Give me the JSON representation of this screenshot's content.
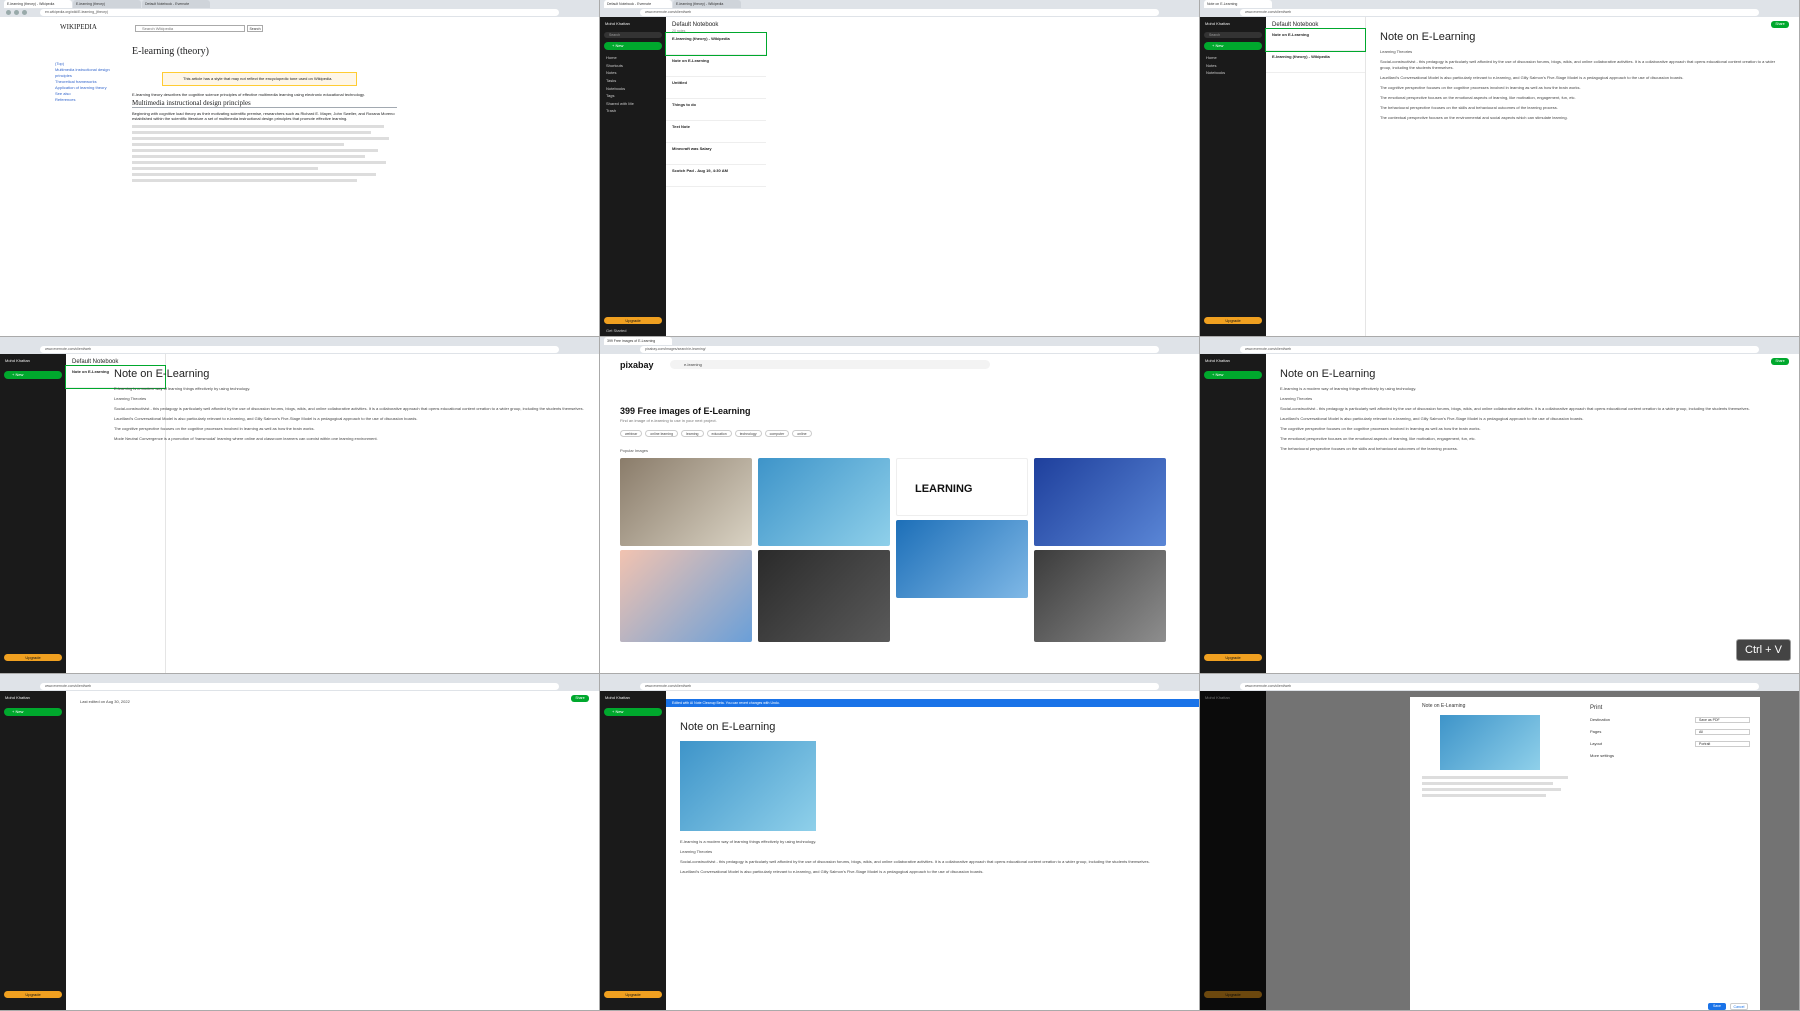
{
  "tabs": {
    "wiki": "E-learning (theory) - Wikipedia",
    "evernote_home": "Default Notebook - Evernote",
    "evernote_note": "Note on E-Learning",
    "pixabay": "399 Free images of E-Learning",
    "wiki_theory": "E-learning (theory)"
  },
  "urls": {
    "wiki": "en.wikipedia.org/wiki/E-learning_(theory)",
    "evernote": "www.evernote.com/client/web",
    "pixabay": "pixabay.com/images/search/e-learning/"
  },
  "evernote": {
    "user": "Mohd Khattan",
    "search": "Search",
    "new": "+ New",
    "nav": [
      "Home",
      "Shortcuts",
      "Notes",
      "Tasks",
      "Notebooks",
      "Tags",
      "Shared with Me",
      "Trash"
    ],
    "shortcuts": [
      "salary",
      "Example",
      "Untitled"
    ],
    "recent": [
      "Note on E-Learning",
      "E-learning (theory)",
      "Untitled",
      "Things to do",
      "Text Note",
      "Scotch Pad"
    ],
    "notebooks": [
      "(second) Library",
      "Default Notebook",
      "jewellery",
      "salary"
    ],
    "tags": [
      "example",
      "jokes",
      "salary"
    ],
    "upgrade": "Upgrade",
    "get_started": "Get Started",
    "list_title": "Default Notebook",
    "list_count": "20 notes",
    "notes": [
      {
        "title": "E-learning (theory) - Wikipedia",
        "snippet": "Learning Theories Social-constructivist"
      },
      {
        "title": "Note on E-Learning",
        "snippet": "E-learning is a modern way of learning"
      },
      {
        "title": "Untitled",
        "snippet": ""
      },
      {
        "title": "Things to do",
        "snippet": "Test"
      },
      {
        "title": "Text Note",
        "snippet": "Text Note Forest Flash"
      },
      {
        "title": "Minecraft was Salary",
        "snippet": "Date & Time: 30th August 2022"
      },
      {
        "title": "Scotch Pad - Aug 19, 4:30 AM",
        "snippet": ""
      }
    ],
    "share": "Share",
    "note_title": "Note on E-Learning",
    "intro": "E-learning is a modern way of learning things effectively by using technology.",
    "heading": "Learning Theories",
    "paras": [
      "Social-constructivist - this pedagogy is particularly well afforded by the use of discussion forums, blogs, wikis, and online collaborative activities. It is a collaborative approach that opens educational content creation to a wider group, including the students themselves.",
      "Laurillard's Conversational Model is also particularly relevant to e-learning, and Gilly Salmon's Five-Stage Model is a pedagogical approach to the use of discussion boards.",
      "The cognitive perspective focuses on the cognitive processes involved in learning as well as how the brain works.",
      "The emotional perspective focuses on the emotional aspects of learning, like motivation, engagement, fun, etc.",
      "The behavioural perspective focuses on the skills and behavioural outcomes of the learning process.",
      "The contextual perspective focuses on the environmental and social aspects which can stimulate learning.",
      "Mode Neutral Convergence is a promotion of 'transmodal' learning where online and classroom learners can coexist within one learning environment."
    ],
    "last_edited": "Last edited on Aug 30, 2022",
    "banner": "Edited with AI Note Cleanup Beta. You can revert changes with Undo.",
    "send_feedback": "Send feedback",
    "add_tag": "Add tag"
  },
  "wiki": {
    "logo": "WIKIPEDIA",
    "search": "Search Wikipedia",
    "search_btn": "Search",
    "title": "E-learning (theory)",
    "toc": [
      "(Top)",
      "Multimedia instructional design principles",
      "Theoretical frameworks",
      "Application of learning theory",
      "See also",
      "References"
    ],
    "warning": "This article has a style that may not reflect the encyclopedic tone used on Wikipedia.",
    "lead": "E-learning theory describes the cognitive science principles of effective multimedia learning using electronic educational technology.",
    "h2": "Multimedia instructional design principles",
    "body": "Beginning with cognitive load theory as their motivating scientific premise, researchers such as Richard E. Mayer, John Sweller, and Roxana Moreno established within the scientific literature a set of multimedia instructional design principles that promote effective learning."
  },
  "pixabay": {
    "logo": "pixabay",
    "search": "e-learning",
    "title": "399 Free images of E-Learning",
    "subtitle": "Find an image of e-learning to use in your next project.",
    "chips": [
      "webinar",
      "online learning",
      "learning",
      "education",
      "technology",
      "computer",
      "online",
      "teacher",
      "learning"
    ],
    "popular": "Popular Images",
    "learning_text": "LEARNING"
  },
  "print": {
    "title": "Print",
    "rows": [
      {
        "label": "Destination",
        "value": "Save as PDF"
      },
      {
        "label": "Pages",
        "value": "All"
      },
      {
        "label": "Layout",
        "value": "Portrait"
      },
      {
        "label": "More settings",
        "value": ""
      }
    ],
    "save": "Save",
    "cancel": "Cancel"
  },
  "overlay": "Ctrl + V",
  "colors": {
    "evernote_green": "#00a82d",
    "evernote_dark": "#1a1a1a",
    "wiki_link": "#3366cc"
  }
}
